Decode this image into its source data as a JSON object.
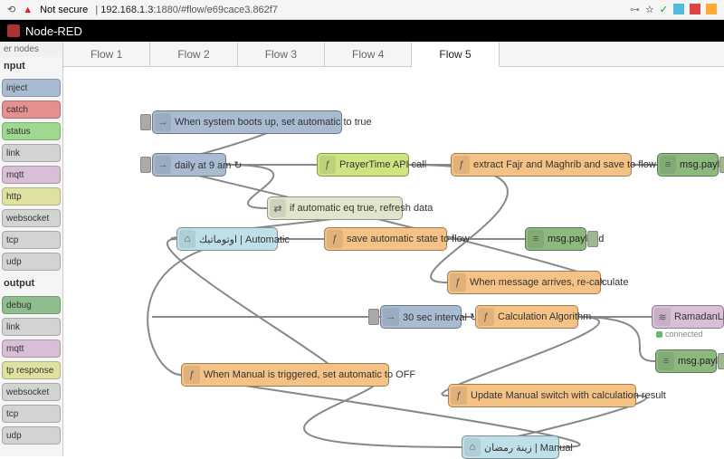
{
  "browser": {
    "not_secure": "Not secure",
    "host": "192.168.1.3",
    "path": ":1880/#flow/e69cace3.862f7"
  },
  "app_title": "Node-RED",
  "palette": {
    "filter": "er nodes",
    "input_label": "nput",
    "output_label": "output",
    "input": [
      "inject",
      "catch",
      "status",
      "link",
      "mqtt",
      "http",
      "websocket",
      "tcp",
      "udp"
    ],
    "output": [
      "debug",
      "link",
      "mqtt",
      "tp response",
      "websocket",
      "tcp",
      "udp"
    ]
  },
  "tabs": [
    "Flow 1",
    "Flow 2",
    "Flow 3",
    "Flow 4",
    "Flow 5"
  ],
  "active_tab": 4,
  "nodes": {
    "boot": "When system boots up, set automatic to true",
    "daily": "daily at 9 am ↻",
    "prayer": "PrayerTime API call",
    "extract": "extract Fajr and Maghrib and save to flow",
    "dbg1": "msg.payload",
    "ifauto": "if automatic eq true, refresh data",
    "autoswitch": "اوتوماتيك | Automatic",
    "savestate": "save automatic state to flow",
    "dbg2": "msg.payload",
    "recalc": "When message arrives, re-calculate",
    "interval": "30 sec interval ↻",
    "calc": "Calculation Algorithm",
    "lights": "RamadanLights",
    "lights_status": "connected",
    "dbg3": "msg.payload",
    "manualoff": "When Manual is triggered, set automatic to OFF",
    "updmanual": "Update Manual switch with calculation result",
    "manualswitch": "زينة رمضان | Manual"
  }
}
